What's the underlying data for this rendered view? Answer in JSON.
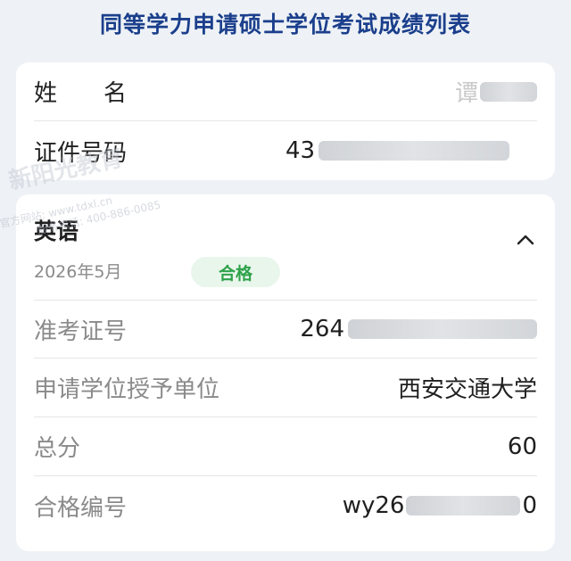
{
  "page": {
    "title": "同等学力申请硕士学位考试成绩列表"
  },
  "personal": {
    "name_label": "姓　　名",
    "name_value": "谭",
    "id_label": "证件号码",
    "id_value": "43"
  },
  "exam": {
    "subject": "英语",
    "date": "2026年5月",
    "status": "合格",
    "expand_icon": "chevron-up-icon",
    "status_color": "#2ea24a",
    "rows": [
      {
        "label": "准考证号",
        "value": "264"
      },
      {
        "label": "申请学位授予单位",
        "value": "西安交通大学"
      },
      {
        "label": "总分",
        "value": "60"
      },
      {
        "label": "合格编号",
        "value": "wy26"
      }
    ],
    "cert_suffix": "0"
  },
  "watermark": {
    "brand": "新阳光教育",
    "site": "官方网站: www.tdxl.cn",
    "phone": "服务电话: 400-886-0085"
  },
  "colors": {
    "title": "#1b3f8c",
    "background": "#eef2f6",
    "badge_bg": "#e9f6ec"
  }
}
